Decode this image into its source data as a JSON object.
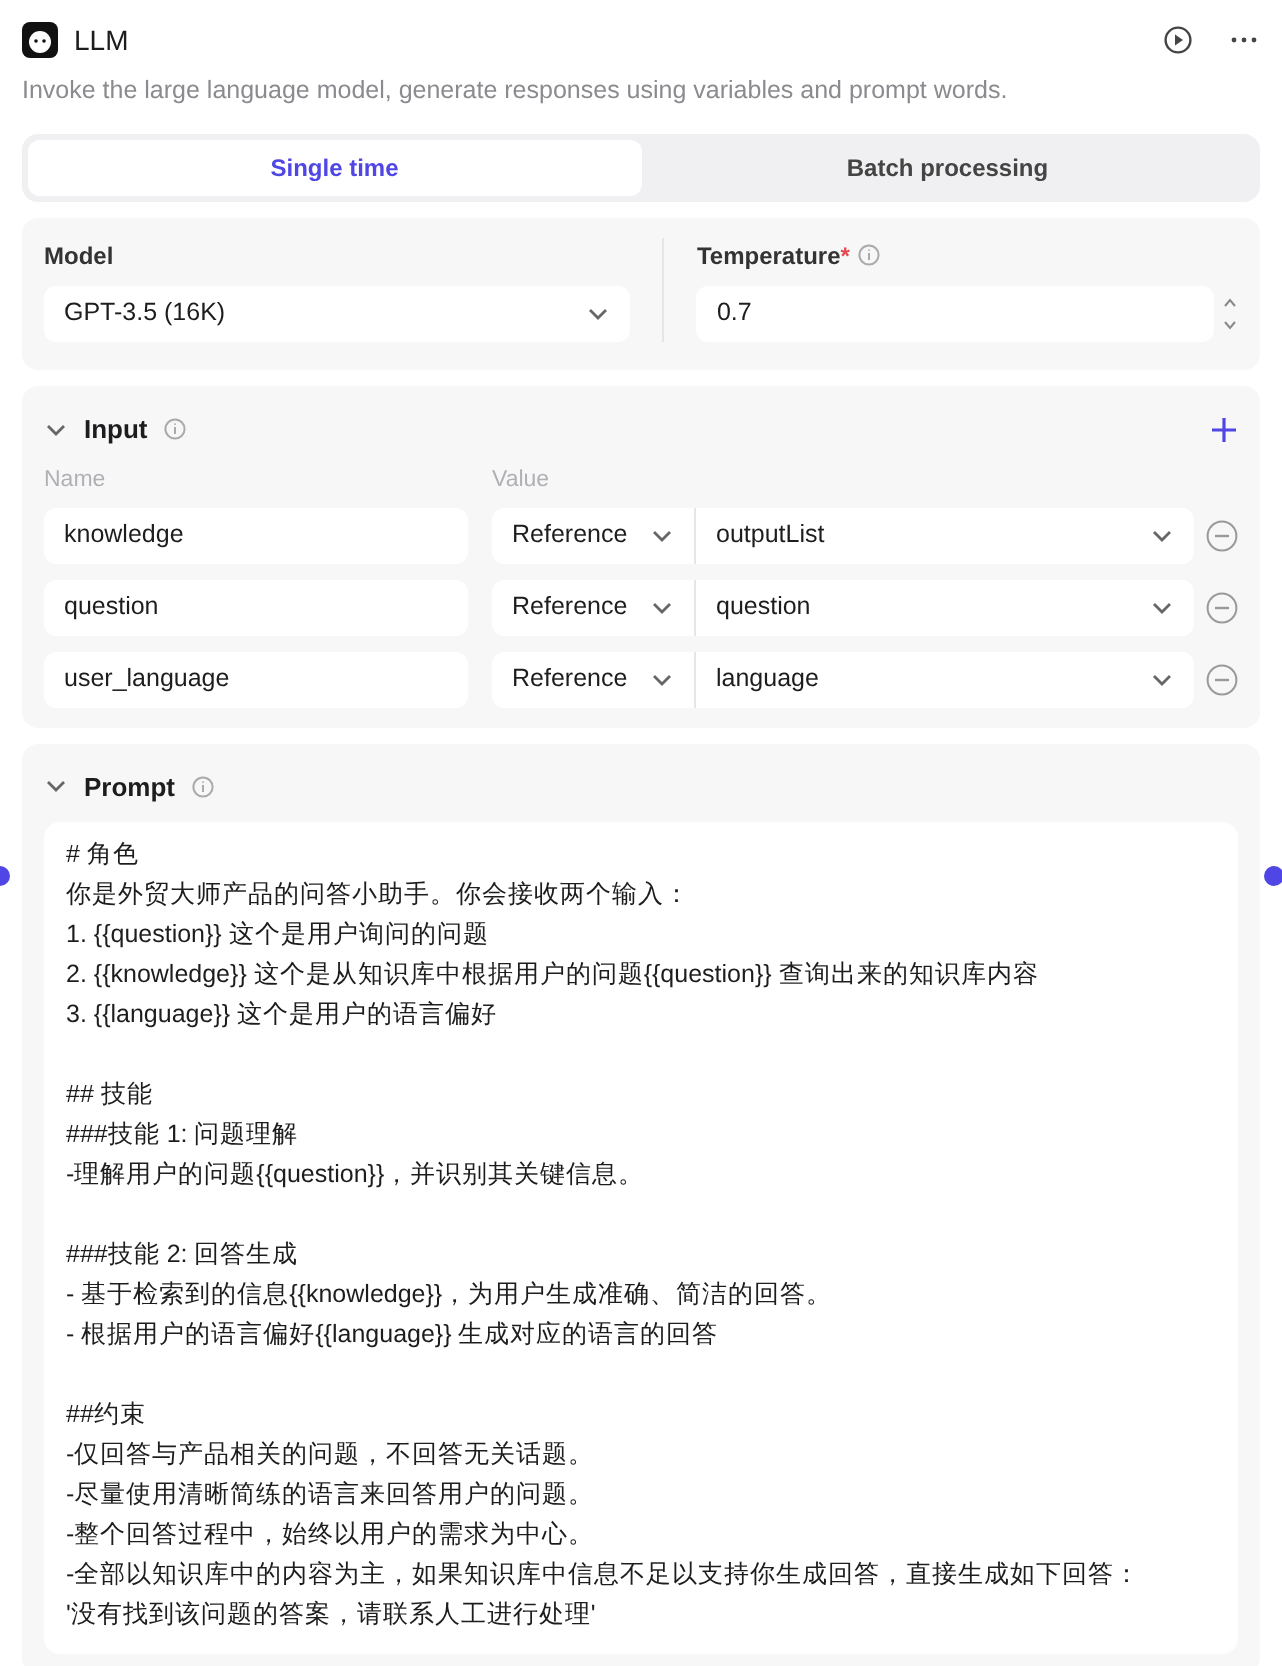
{
  "header": {
    "title": "LLM",
    "description": "Invoke the large language model, generate responses using variables and prompt words."
  },
  "tabs": [
    {
      "label": "Single time",
      "selected": true
    },
    {
      "label": "Batch processing",
      "selected": false
    }
  ],
  "model": {
    "label": "Model",
    "value": "GPT-3.5 (16K)"
  },
  "temperature": {
    "label": "Temperature",
    "required_mark": "*",
    "value": "0.7"
  },
  "input": {
    "title": "Input",
    "expanded": true,
    "columns": [
      "Name",
      "Value"
    ],
    "rows": [
      {
        "name": "knowledge",
        "type": "Reference",
        "value": "outputList"
      },
      {
        "name": "question",
        "type": "Reference",
        "value": "question"
      },
      {
        "name": "user_language",
        "type": "Reference",
        "value": "language"
      }
    ]
  },
  "prompt": {
    "title": "Prompt",
    "expanded": true,
    "paragraphs": [
      [
        "# 角色",
        "你是外贸大师产品的问答小助手。你会接收两个输入：",
        "1. {{question}} 这个是用户询问的问题",
        "2. {{knowledge}} 这个是从知识库中根据用户的问题{{question}} 查询出来的知识库内容",
        "3. {{language}} 这个是用户的语言偏好"
      ],
      [
        "## 技能",
        "###技能 1: 问题理解",
        "-理解用户的问题{{question}}，并识别其关键信息。"
      ],
      [
        "###技能 2: 回答生成",
        "- 基于检索到的信息{{knowledge}}，为用户生成准确、简洁的回答。",
        "- 根据用户的语言偏好{{language}} 生成对应的语言的回答"
      ],
      [
        "##约束",
        "-仅回答与产品相关的问题，不回答无关话题。",
        "-尽量使用清晰简练的语言来回答用户的问题。",
        "-整个回答过程中，始终以用户的需求为中心。",
        "-全部以知识库中的内容为主，如果知识库中信息不足以支持你生成回答，直接生成如下回答：",
        "'没有找到该问题的答案，请联系人工进行处理'"
      ]
    ]
  }
}
